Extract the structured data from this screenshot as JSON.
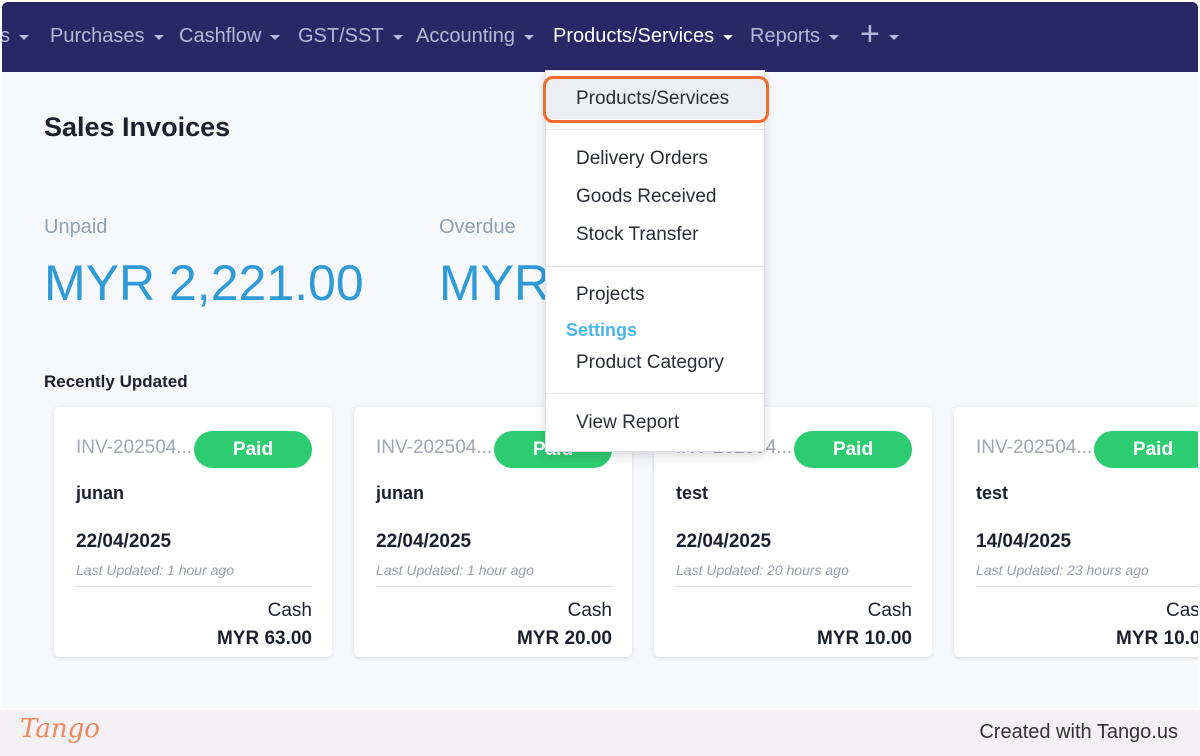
{
  "navbar": {
    "items": [
      {
        "label": "s"
      },
      {
        "label": "Purchases"
      },
      {
        "label": "Cashflow"
      },
      {
        "label": "GST/SST"
      },
      {
        "label": "Accounting"
      },
      {
        "label": "Products/Services"
      },
      {
        "label": "Reports"
      },
      {
        "label": "+"
      }
    ],
    "active": "Products/Services",
    "background": "#2a2766"
  },
  "page": {
    "title": "Sales Invoices",
    "unpaid_label": "Unpaid",
    "unpaid_value": "MYR 2,221.00",
    "overdue_label": "Overdue",
    "overdue_value": "MYR",
    "recent_title": "Recently Updated"
  },
  "cards": [
    {
      "invoice": "INV-202504...",
      "status": "Paid",
      "customer": "junan",
      "date": "22/04/2025",
      "updated": "Last Updated: 1 hour ago",
      "method": "Cash",
      "amount": "MYR 63.00"
    },
    {
      "invoice": "INV-202504...",
      "status": "Paid",
      "customer": "junan",
      "date": "22/04/2025",
      "updated": "Last Updated: 1 hour ago",
      "method": "Cash",
      "amount": "MYR 20.00"
    },
    {
      "invoice": "INV-202504...",
      "status": "Paid",
      "customer": "test",
      "date": "22/04/2025",
      "updated": "Last Updated: 20 hours ago",
      "method": "Cash",
      "amount": "MYR 10.00"
    },
    {
      "invoice": "INV-202504...",
      "status": "Paid",
      "customer": "test",
      "date": "14/04/2025",
      "updated": "Last Updated: 23 hours ago",
      "method": "Cash",
      "amount": "MYR 10.0"
    }
  ],
  "dropdown": {
    "items": {
      "products_services": "Products/Services",
      "delivery_orders": "Delivery Orders",
      "goods_received": "Goods Received",
      "stock_transfer": "Stock Transfer",
      "projects": "Projects",
      "settings_header": "Settings",
      "product_category": "Product Category",
      "view_report": "View Report"
    },
    "highlighted": "Products/Services"
  },
  "footer": {
    "logo": "Tango",
    "credit": "Created with Tango.us"
  },
  "colors": {
    "accent": "#2e9ad8",
    "paid": "#2ecc71",
    "highlight_ring": "#f26a2e",
    "settings_header": "#48b6e8"
  }
}
